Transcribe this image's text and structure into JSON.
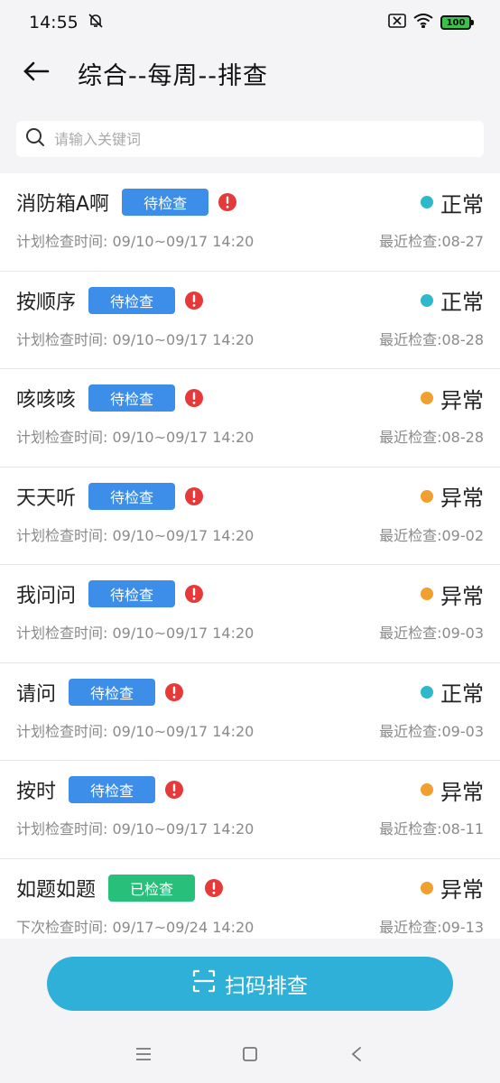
{
  "status_bar": {
    "time": "14:55",
    "battery": "100"
  },
  "header": {
    "title": "综合--每周--排查"
  },
  "search": {
    "placeholder": "请输入关键词",
    "value": ""
  },
  "colors": {
    "badge_pending": "#3d8ee8",
    "badge_done": "#27c07a",
    "dot_normal": "#2fb8c9",
    "dot_abnormal": "#f0a030",
    "warn": "#e63a3a",
    "scan_button": "#2fb0d8"
  },
  "items": [
    {
      "name": "消防箱A啊",
      "badge": "待检查",
      "badge_type": "pending",
      "status": "正常",
      "status_type": "normal",
      "time_label": "计划检查时间",
      "time_range": "09/10~09/17 14:20",
      "last_check": "最近检查:08-27"
    },
    {
      "name": "按顺序",
      "badge": "待检查",
      "badge_type": "pending",
      "status": "正常",
      "status_type": "normal",
      "time_label": "计划检查时间",
      "time_range": "09/10~09/17 14:20",
      "last_check": "最近检查:08-28"
    },
    {
      "name": "咳咳咳",
      "badge": "待检查",
      "badge_type": "pending",
      "status": "异常",
      "status_type": "abnormal",
      "time_label": "计划检查时间",
      "time_range": "09/10~09/17 14:20",
      "last_check": "最近检查:08-28"
    },
    {
      "name": "天天听",
      "badge": "待检查",
      "badge_type": "pending",
      "status": "异常",
      "status_type": "abnormal",
      "time_label": "计划检查时间",
      "time_range": "09/10~09/17 14:20",
      "last_check": "最近检查:09-02"
    },
    {
      "name": "我问问",
      "badge": "待检查",
      "badge_type": "pending",
      "status": "异常",
      "status_type": "abnormal",
      "time_label": "计划检查时间",
      "time_range": "09/10~09/17 14:20",
      "last_check": "最近检查:09-03"
    },
    {
      "name": "请问",
      "badge": "待检查",
      "badge_type": "pending",
      "status": "正常",
      "status_type": "normal",
      "time_label": "计划检查时间",
      "time_range": "09/10~09/17 14:20",
      "last_check": "最近检查:09-03"
    },
    {
      "name": "按时",
      "badge": "待检查",
      "badge_type": "pending",
      "status": "异常",
      "status_type": "abnormal",
      "time_label": "计划检查时间",
      "time_range": "09/10~09/17 14:20",
      "last_check": "最近检查:08-11"
    },
    {
      "name": "如题如题",
      "badge": "已检查",
      "badge_type": "done",
      "status": "异常",
      "status_type": "abnormal",
      "time_label": "下次检查时间",
      "time_range": "09/17~09/24 14:20",
      "last_check": "最近检查:09-13"
    }
  ],
  "scan_button": {
    "label": "扫码排查",
    "icon": "scan-icon"
  },
  "nav": {
    "icons": [
      "menu-icon",
      "home-icon",
      "back-icon"
    ]
  }
}
